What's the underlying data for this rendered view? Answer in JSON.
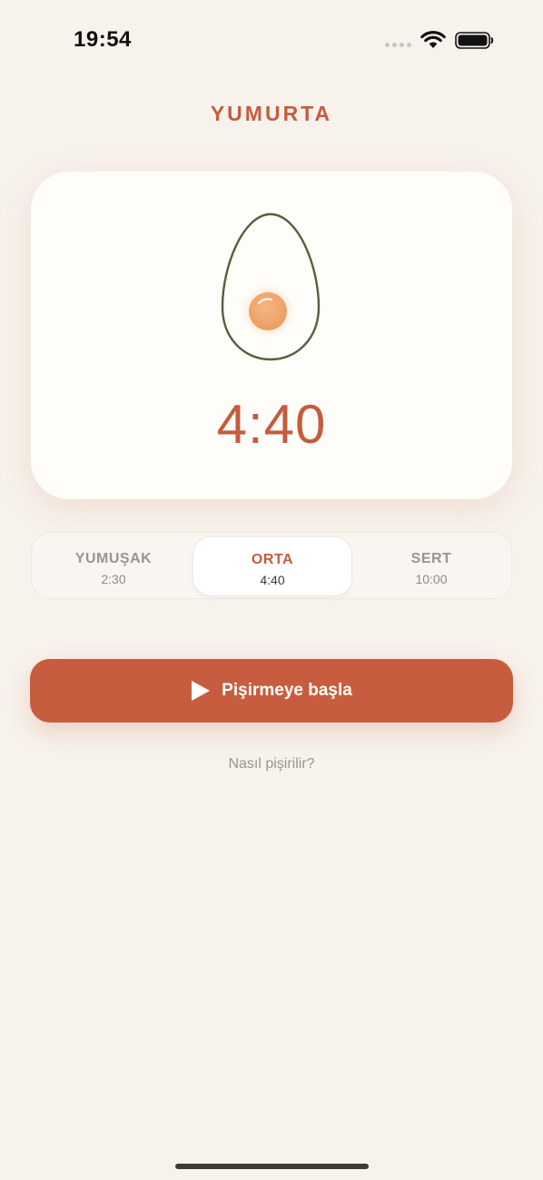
{
  "status_bar": {
    "time": "19:54",
    "wifi_icon": "wifi-icon",
    "battery_icon": "battery-icon"
  },
  "header": {
    "title": "YUMURTA"
  },
  "timer": {
    "display": "4:40",
    "illustration": "egg-icon"
  },
  "modes": [
    {
      "label": "YUMUŞAK",
      "time": "2:30",
      "selected": false
    },
    {
      "label": "ORTA",
      "time": "4:40",
      "selected": true
    },
    {
      "label": "SERT",
      "time": "10:00",
      "selected": false
    }
  ],
  "actions": {
    "start_label": "Pişirmeye başla",
    "start_icon": "play-icon",
    "help_link": "Nasıl pişirilir?"
  },
  "colors": {
    "accent": "#C45C3D",
    "background": "#F7F2EC",
    "card": "#FFFDFA",
    "yolk": "#F0A56E",
    "egg_outline": "#55603F"
  }
}
